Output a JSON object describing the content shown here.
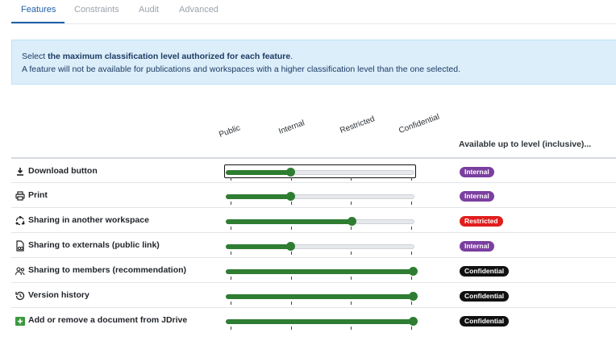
{
  "tabs": [
    {
      "label": "Features",
      "active": true
    },
    {
      "label": "Constraints",
      "active": false
    },
    {
      "label": "Audit",
      "active": false
    },
    {
      "label": "Advanced",
      "active": false
    }
  ],
  "banner": {
    "line1_prefix": "Select ",
    "line1_bold": "the maximum classification level authorized for each feature",
    "line1_suffix": ".",
    "line2": "A feature will not be available for publications and workspaces with a higher classification level than the one selected."
  },
  "levels": [
    "Public",
    "Internal",
    "Restricted",
    "Confidential"
  ],
  "available_header": "Available up to level (inclusive)...",
  "colors": {
    "accent": "#1f5fa8",
    "slider_fill": "#2e7d32",
    "internal": "#7b3fa0",
    "restricted": "#e11d1d",
    "confidential": "#111111"
  },
  "features": [
    {
      "label": "Download button",
      "icon": "download-icon",
      "level_index": 1,
      "badge": "Internal",
      "focused": true
    },
    {
      "label": "Print",
      "icon": "printer-icon",
      "level_index": 1,
      "badge": "Internal",
      "focused": false
    },
    {
      "label": "Sharing in another workspace",
      "icon": "share-cycle-icon",
      "level_index": 2,
      "badge": "Restricted",
      "focused": false
    },
    {
      "label": "Sharing to externals (public link)",
      "icon": "public-link-icon",
      "level_index": 1,
      "badge": "Internal",
      "focused": false
    },
    {
      "label": "Sharing to members (recommendation)",
      "icon": "members-icon",
      "level_index": 3,
      "badge": "Confidential",
      "focused": false
    },
    {
      "label": "Version history",
      "icon": "history-icon",
      "level_index": 3,
      "badge": "Confidential",
      "focused": false
    },
    {
      "label": "Add or remove a document from JDrive",
      "icon": "jdrive-icon",
      "level_index": 3,
      "badge": "Confidential",
      "focused": false
    }
  ]
}
